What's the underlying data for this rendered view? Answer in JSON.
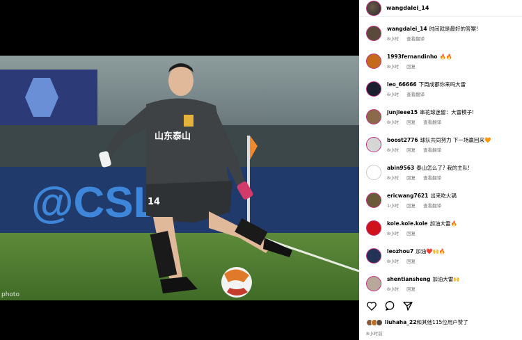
{
  "photo": {
    "watermark": "photo",
    "jersey_text": "山东泰山",
    "jersey_number": "14",
    "banner_text": "@CSL"
  },
  "post": {
    "author": "wangdalei_14",
    "time": "8小时前"
  },
  "comments": [
    {
      "user": "wangdalei_14",
      "text": "时间就是最好的答案!",
      "time": "8小时",
      "actions": [
        "查看翻译"
      ],
      "avatar_color": "#5a4a3c"
    },
    {
      "user": "1993fernandinho",
      "text": "🔥🔥",
      "time": "8小时",
      "actions": [
        "回复"
      ],
      "avatar_color": "#c46a1d"
    },
    {
      "user": "leo_66666",
      "text": "下周成都你来吗大雷",
      "time": "6小时",
      "actions": [
        "查看翻译"
      ],
      "avatar_color": "#1a2030"
    },
    {
      "user": "junjieee15",
      "text": "串花球迷留：大雷模子!",
      "time": "8小时",
      "actions": [
        "回复",
        "查看翻译"
      ],
      "avatar_color": "#8a6a48"
    },
    {
      "user": "boost2776",
      "text": "球队共同努力 下一场赢回来🧡",
      "time": "8小时",
      "actions": [
        "回复",
        "查看翻译"
      ],
      "avatar_color": "#d6d6d6"
    },
    {
      "user": "abin9563",
      "text": "泰山怎么了? 我的主队!",
      "time": "8小时",
      "actions": [
        "回复",
        "查看翻译"
      ],
      "avatar_color": "#ffffff"
    },
    {
      "user": "ericwang7621",
      "text": "出来吃火锅",
      "time": "1小时",
      "actions": [
        "回复",
        "查看翻译"
      ],
      "avatar_color": "#6b5a3a"
    },
    {
      "user": "kole.kole.kole",
      "text": "加油大雷🔥",
      "time": "8小时",
      "actions": [
        "回复"
      ],
      "avatar_color": "#d0121b"
    },
    {
      "user": "leozhou7",
      "text": "加油❤️🙌🔥",
      "time": "8小时",
      "actions": [
        "回复"
      ],
      "avatar_color": "#223355"
    },
    {
      "user": "shentiansheng",
      "text": "加油大雷🙌",
      "time": "8小时",
      "actions": [
        "回复"
      ],
      "avatar_color": "#b8a89a"
    }
  ],
  "likes": {
    "user": "liuhaha_22",
    "text": "和其他115位用户赞了"
  },
  "icons": [
    "heart-icon",
    "comment-icon",
    "share-icon"
  ]
}
